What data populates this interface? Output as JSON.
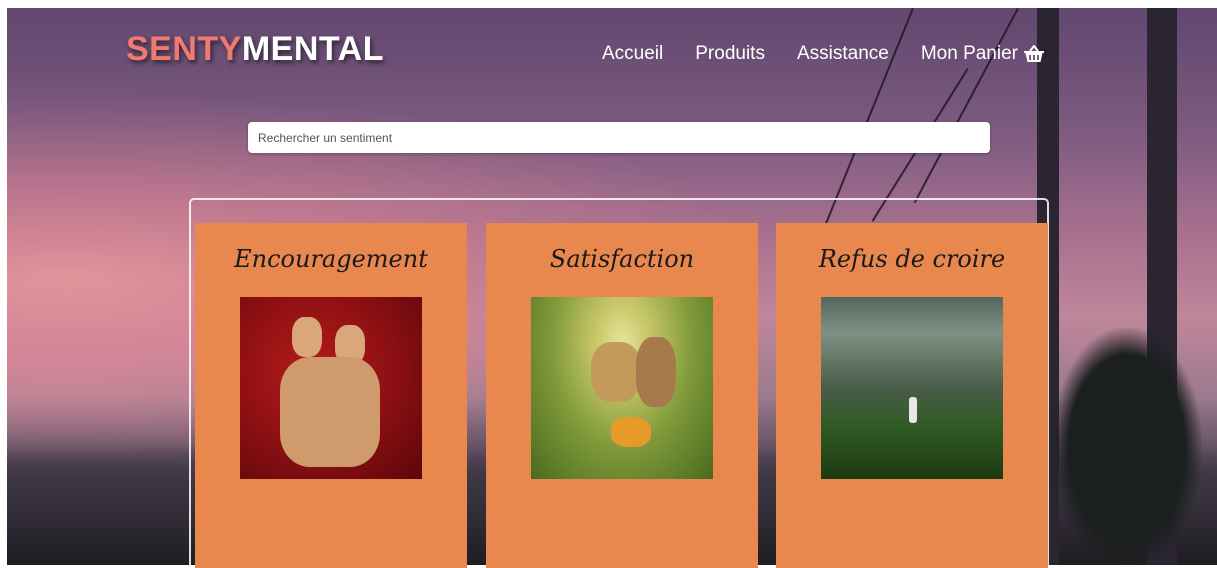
{
  "brand": {
    "part1": "SENTY",
    "part2": "MENTAL"
  },
  "nav": {
    "items": [
      {
        "label": "Accueil"
      },
      {
        "label": "Produits"
      },
      {
        "label": "Assistance"
      },
      {
        "label": "Mon Panier",
        "icon": "basket-icon"
      }
    ]
  },
  "search": {
    "placeholder": "Rechercher un sentiment",
    "value": ""
  },
  "products": [
    {
      "title": "Encouragement",
      "image": "wooden-figures-hug-image"
    },
    {
      "title": "Satisfaction",
      "image": "girl-lying-in-grass-image"
    },
    {
      "title": "Refus de croire",
      "image": "person-in-green-valley-image"
    }
  ],
  "colors": {
    "card": "#e8884e",
    "logo_accent": "#ee7a70",
    "text_light": "#ffffff"
  }
}
